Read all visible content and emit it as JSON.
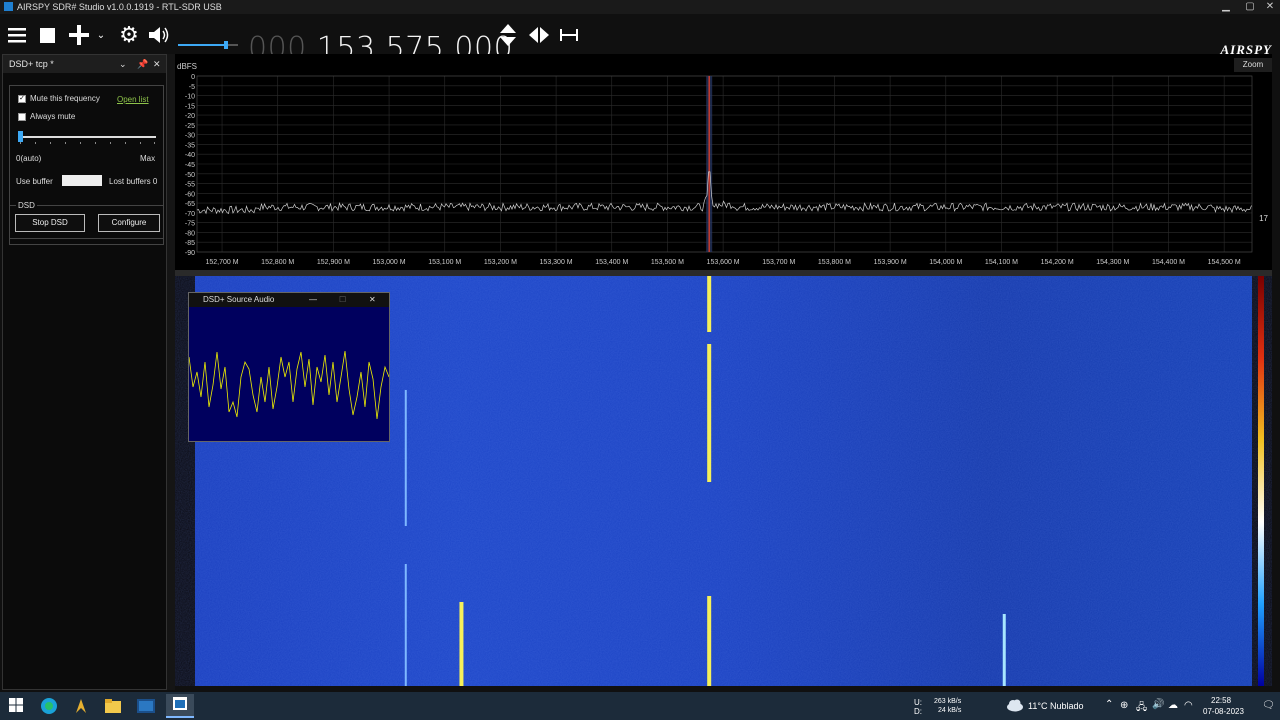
{
  "window": {
    "title": "AIRSPY SDR# Studio v1.0.0.1919 - RTL-SDR USB",
    "minimize": "▁",
    "maximize": "▢",
    "close": "✕"
  },
  "toolbar": {
    "freq_dim": "000.",
    "freq_lit": "153.575.000",
    "logo": "AIRSPY",
    "volume_level": 0.8
  },
  "left_panel": {
    "title": "DSD+ tcp *",
    "mute_freq_label": "Mute this frequency",
    "mute_freq_checked": true,
    "open_list_link": "Open list",
    "always_mute_label": "Always mute",
    "always_mute_checked": false,
    "slider_min_label": "0(auto)",
    "slider_max_label": "Max",
    "slider_level": 0.0,
    "use_buffer_label": "Use buffer",
    "lost_buffers_label": "Lost buffers 0",
    "dsd_group_label": "DSD",
    "stop_button": "Stop DSD",
    "configure_button": "Configure"
  },
  "spectrum": {
    "y_unit": "dBFS",
    "zoom_button": "Zoom",
    "right_value": "17",
    "y_ticks": [
      "0",
      "-5",
      "-10",
      "-15",
      "-20",
      "-25",
      "-30",
      "-35",
      "-40",
      "-45",
      "-50",
      "-55",
      "-60",
      "-65",
      "-70",
      "-75",
      "-80",
      "-85",
      "-90"
    ],
    "x_ticks": [
      "152,700 M",
      "152,800 M",
      "152,900 M",
      "153,000 M",
      "153,100 M",
      "153,200 M",
      "153,300 M",
      "153,400 M",
      "153,500 M",
      "153,600 M",
      "153,700 M",
      "153,800 M",
      "153,900 M",
      "154,000 M",
      "154,100 M",
      "154,200 M",
      "154,300 M",
      "154,400 M",
      "154,500 M"
    ],
    "tuned_freq_mhz": 153.575,
    "x_range_mhz": [
      152.655,
      154.55
    ],
    "noise_floor_db": -67,
    "peak_db": -49
  },
  "audio_window": {
    "title": "DSD+ Source Audio",
    "minimize": "—",
    "maximize": "☐",
    "close": "✕"
  },
  "waterfall": {
    "signals": [
      {
        "freq_mhz": 153.575,
        "color": "#f5f05a"
      },
      {
        "freq_mhz": 153.03,
        "color": "#7fb8ff"
      },
      {
        "freq_mhz": 153.13,
        "color": "#f5f05a"
      },
      {
        "freq_mhz": 154.105,
        "color": "#a8e6ff"
      }
    ]
  },
  "taskbar": {
    "net_up": "263 kB/s",
    "net_down": "24 kB/s",
    "net_up_label": "U:",
    "net_down_label": "D:",
    "weather": "11°C  Nublado",
    "time": "22:58",
    "date": "07-08-2023"
  }
}
